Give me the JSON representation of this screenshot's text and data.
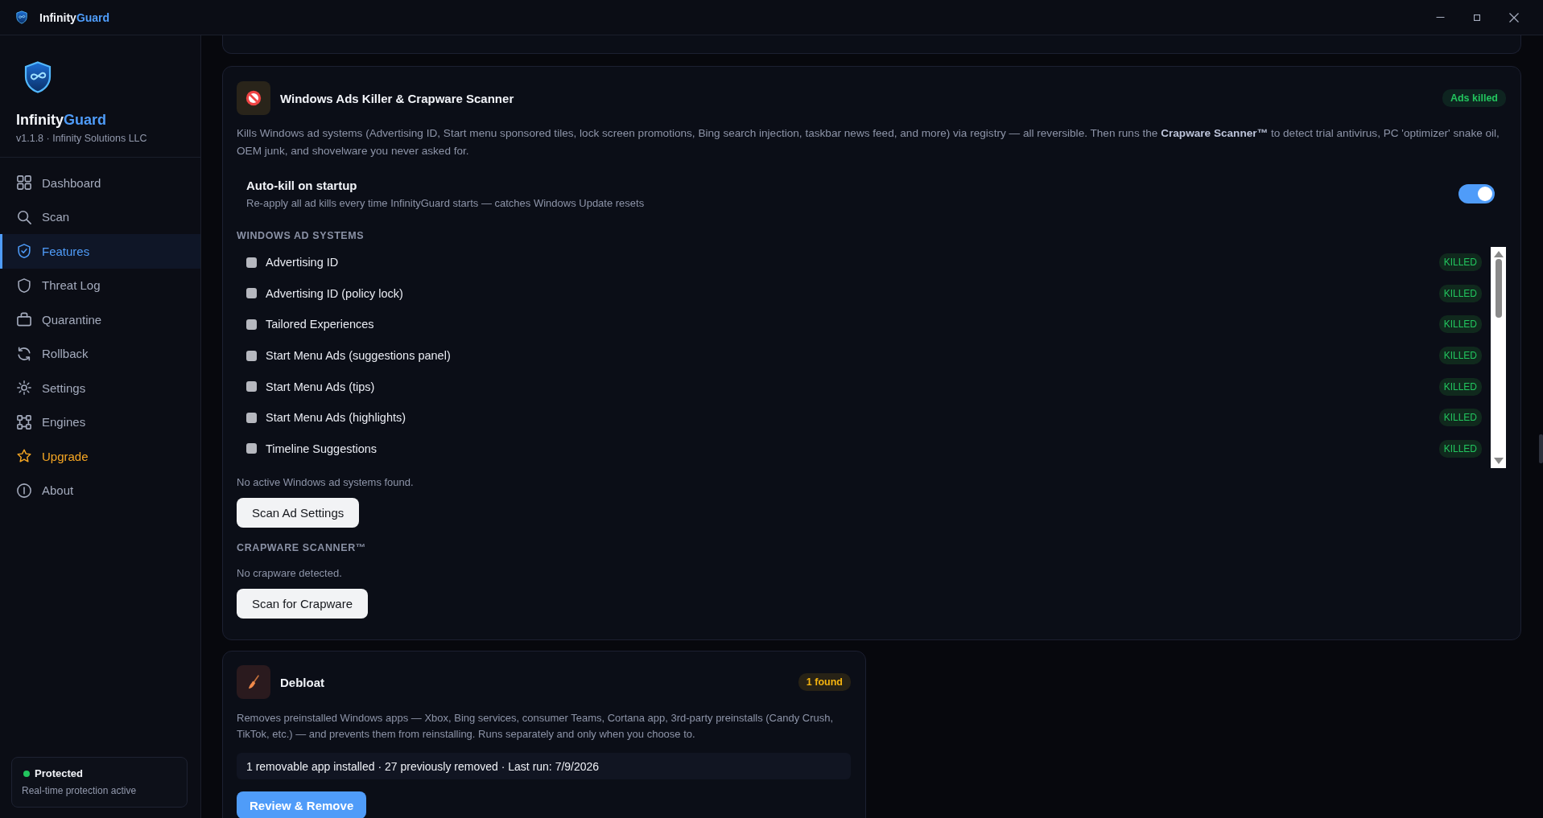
{
  "window": {
    "title_parts": [
      "Infinity",
      "Guard"
    ]
  },
  "sidebar": {
    "brand_parts": [
      "Infinity",
      "Guard"
    ],
    "subtitle": "v1.1.8 · Infinity Solutions LLC",
    "nav": [
      {
        "label": "Dashboard",
        "kind": "page",
        "selected": false
      },
      {
        "label": "Scan",
        "kind": "page",
        "selected": false
      },
      {
        "label": "Features",
        "kind": "page",
        "selected": true
      },
      {
        "label": "Threat Log",
        "kind": "page",
        "selected": false
      },
      {
        "label": "Quarantine",
        "kind": "page",
        "selected": false
      },
      {
        "label": "Rollback",
        "kind": "page",
        "selected": false
      },
      {
        "label": "Settings",
        "kind": "page",
        "selected": false
      },
      {
        "label": "Engines",
        "kind": "page",
        "selected": false
      },
      {
        "label": "Upgrade",
        "kind": "upgrade",
        "selected": false
      },
      {
        "label": "About",
        "kind": "page",
        "selected": false
      }
    ],
    "status": {
      "title": "Protected",
      "subtitle": "Real-time protection active",
      "protected": true
    }
  },
  "feature_cards": [
    {
      "kind": "ads",
      "title": "Windows Ads Killer & Crapware Scanner",
      "badge": {
        "label": "Ads killed",
        "color": "#22c55e"
      },
      "description": "Kills Windows ad systems (Advertising ID, Start menu sponsored tiles, lock screen promotions, Bing search injection, taskbar news feed, and more) via registry — all reversible. Then runs the **Crapware Scanner™** to detect trial antivirus, PC 'optimizer' snake oil, OEM junk, and shovelware you never asked for.",
      "setting": {
        "title": "Auto-kill on startup",
        "description": "Re-apply all ad kills every time InfinityGuard starts — catches Windows Update resets",
        "on": true
      },
      "sections": [
        {
          "heading": "WINDOWS AD SYSTEMS",
          "items": [
            {
              "label": "Advertising ID",
              "checked": false,
              "status": "KILLED"
            },
            {
              "label": "Advertising ID (policy lock)",
              "checked": false,
              "status": "KILLED"
            },
            {
              "label": "Tailored Experiences",
              "checked": false,
              "status": "KILLED"
            },
            {
              "label": "Start Menu Ads (suggestions panel)",
              "checked": false,
              "status": "KILLED"
            },
            {
              "label": "Start Menu Ads (tips)",
              "checked": false,
              "status": "KILLED"
            },
            {
              "label": "Start Menu Ads (highlights)",
              "checked": false,
              "status": "KILLED"
            },
            {
              "label": "Timeline Suggestions",
              "checked": false,
              "status": "KILLED"
            }
          ],
          "message": "No active Windows ad systems found.",
          "button": {
            "label": "Scan Ad Settings",
            "kind": "secondary"
          }
        },
        {
          "heading": "CRAPWARE SCANNER™",
          "message": "No crapware detected.",
          "button": {
            "label": "Scan for Crapware",
            "kind": "secondary"
          }
        }
      ]
    },
    {
      "kind": "debloat",
      "title": "Debloat",
      "badge": {
        "label": "1 found",
        "color": "#f5b40f"
      },
      "description": "Removes preinstalled Windows apps — Xbox, Bing services, consumer Teams, Cortana app, 3rd-party preinstalls (Candy Crush, TikTok, etc.) — and prevents them from reinstalling. Runs separately and only when you choose to.",
      "info": "1 removable app installed · 27 previously removed · Last run: 7/9/2026",
      "button": {
        "label": "Review & Remove",
        "kind": "primary"
      }
    }
  ]
}
